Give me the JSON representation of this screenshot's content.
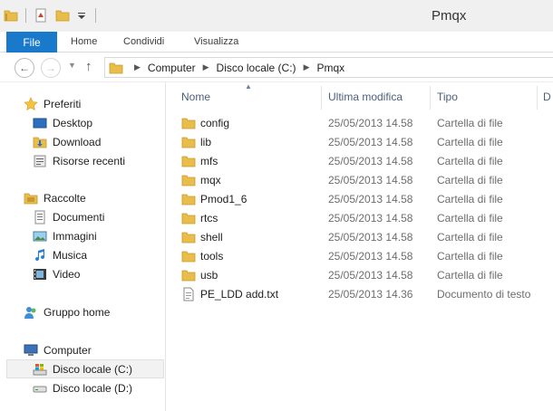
{
  "window": {
    "title": "Pmqx"
  },
  "ribbon": {
    "tabs": [
      "File",
      "Home",
      "Condividi",
      "Visualizza"
    ]
  },
  "address": {
    "crumbs": [
      "Computer",
      "Disco locale (C:)",
      "Pmqx"
    ]
  },
  "navigation": {
    "favorites_header": "Preferiti",
    "favorites": [
      "Desktop",
      "Download",
      "Risorse recenti"
    ],
    "libraries_header": "Raccolte",
    "libraries": [
      "Documenti",
      "Immagini",
      "Musica",
      "Video"
    ],
    "homegroup": "Gruppo home",
    "computer_header": "Computer",
    "drives": [
      "Disco locale (C:)",
      "Disco locale (D:)"
    ]
  },
  "columns": {
    "name": "Nome",
    "modified": "Ultima modifica",
    "type": "Tipo",
    "size": "D"
  },
  "files": [
    {
      "name": "config",
      "modified": "25/05/2013 14.58",
      "type": "Cartella di file",
      "icon": "folder-icon"
    },
    {
      "name": "lib",
      "modified": "25/05/2013 14.58",
      "type": "Cartella di file",
      "icon": "folder-icon"
    },
    {
      "name": "mfs",
      "modified": "25/05/2013 14.58",
      "type": "Cartella di file",
      "icon": "folder-icon"
    },
    {
      "name": "mqx",
      "modified": "25/05/2013 14.58",
      "type": "Cartella di file",
      "icon": "folder-icon"
    },
    {
      "name": "Pmod1_6",
      "modified": "25/05/2013 14.58",
      "type": "Cartella di file",
      "icon": "folder-icon"
    },
    {
      "name": "rtcs",
      "modified": "25/05/2013 14.58",
      "type": "Cartella di file",
      "icon": "folder-icon"
    },
    {
      "name": "shell",
      "modified": "25/05/2013 14.58",
      "type": "Cartella di file",
      "icon": "folder-icon"
    },
    {
      "name": "tools",
      "modified": "25/05/2013 14.58",
      "type": "Cartella di file",
      "icon": "folder-icon"
    },
    {
      "name": "usb",
      "modified": "25/05/2013 14.58",
      "type": "Cartella di file",
      "icon": "folder-icon"
    },
    {
      "name": "PE_LDD add.txt",
      "modified": "25/05/2013 14.36",
      "type": "Documento di testo",
      "icon": "text-file-icon"
    }
  ],
  "colors": {
    "accent": "#1979ca",
    "folder": "#e8bd4a",
    "header_text": "#4c607a"
  }
}
